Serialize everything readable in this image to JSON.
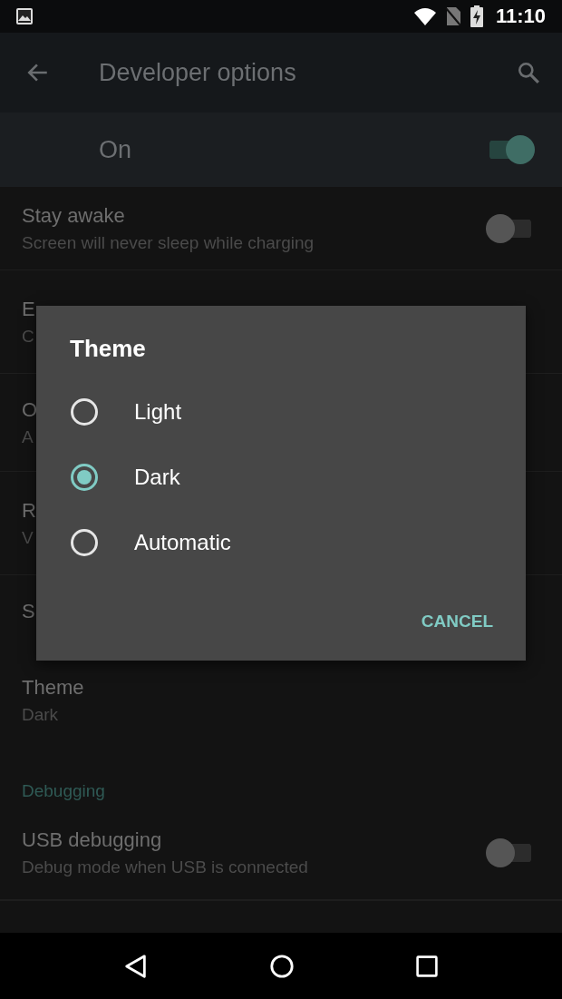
{
  "status_bar": {
    "time": "11:10"
  },
  "toolbar": {
    "title": "Developer options"
  },
  "master_switch": {
    "label": "On",
    "on": true
  },
  "settings": [
    {
      "kind": "switch",
      "title": "Stay awake",
      "summary": "Screen will never sleep while charging",
      "on": false
    },
    {
      "kind": "text",
      "title": "E",
      "summary": "C"
    },
    {
      "kind": "text",
      "title": "O",
      "summary": "A"
    },
    {
      "kind": "text",
      "title": "R",
      "summary": "V"
    },
    {
      "kind": "text",
      "title": "S"
    },
    {
      "kind": "text",
      "title": "Theme",
      "summary": "Dark"
    },
    {
      "kind": "header",
      "title": "Debugging"
    },
    {
      "kind": "switch",
      "title": "USB debugging",
      "summary": "Debug mode when USB is connected",
      "on": false
    }
  ],
  "dialog": {
    "title": "Theme",
    "options": [
      {
        "label": "Light",
        "selected": false
      },
      {
        "label": "Dark",
        "selected": true
      },
      {
        "label": "Automatic",
        "selected": false
      }
    ],
    "button": "CANCEL"
  }
}
